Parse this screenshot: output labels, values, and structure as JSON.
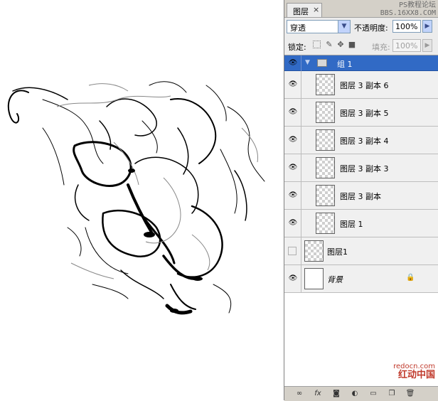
{
  "panel": {
    "tab_label": "图层",
    "tab_close": "×",
    "watermark_top": [
      "PS教程论坛",
      "BBS.16XX8.COM"
    ],
    "blend_mode": "穿透",
    "opacity_label": "不透明度:",
    "opacity_value": "100%",
    "lock_label": "锁定:",
    "fill_label": "填充:",
    "fill_value": "100%"
  },
  "layers": [
    {
      "name": "组 1",
      "type": "group",
      "visible": true,
      "selected": true
    },
    {
      "name": "图层 3 副本 6",
      "type": "layer",
      "visible": true,
      "in_group": true
    },
    {
      "name": "图层 3 副本 5",
      "type": "layer",
      "visible": true,
      "in_group": true
    },
    {
      "name": "图层 3 副本 4",
      "type": "layer",
      "visible": true,
      "in_group": true
    },
    {
      "name": "图层 3 副本 3",
      "type": "layer",
      "visible": true,
      "in_group": true
    },
    {
      "name": "图层 3 副本",
      "type": "layer",
      "visible": true,
      "in_group": true
    },
    {
      "name": "图层 1",
      "type": "layer",
      "visible": true,
      "in_group": true
    },
    {
      "name": "图层1",
      "type": "layer",
      "visible": false,
      "in_group": false
    },
    {
      "name": "背景",
      "type": "background",
      "visible": true,
      "locked": true
    }
  ],
  "watermark_bottom": {
    "line1": "redocn.com",
    "line2": "红动中国"
  },
  "icons": {
    "visibility": "eye-icon",
    "lock": "lock-icon",
    "folder": "folder-icon",
    "footer": [
      "link-icon",
      "fx-icon",
      "mask-icon",
      "adjustment-icon",
      "group-folder-icon",
      "new-layer-icon",
      "trash-icon"
    ]
  },
  "colors": {
    "selection": "#316ac5",
    "panel_bg": "#d4d0c8",
    "watermark_red": "#c0392b"
  }
}
